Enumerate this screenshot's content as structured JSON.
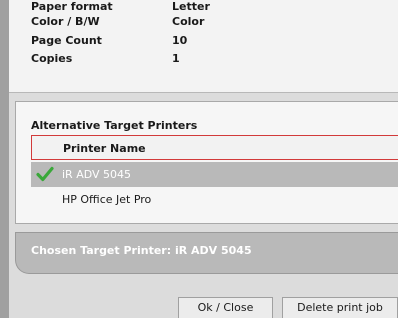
{
  "details": [
    {
      "label": "Paper format",
      "value": "Letter"
    },
    {
      "label": "Color / B/W",
      "value": "Color"
    },
    {
      "label": "Page Count",
      "value": "10"
    },
    {
      "label": "Copies",
      "value": "1"
    }
  ],
  "alternatives": {
    "title": "Alternative Target Printers",
    "column_header": "Printer Name",
    "printers": [
      {
        "name": "iR ADV 5045",
        "selected": true,
        "icon": "checkmark-icon"
      },
      {
        "name": "HP Office Jet Pro",
        "selected": false
      }
    ]
  },
  "chosen": {
    "text": "Chosen Target Printer: iR ADV 5045"
  },
  "buttons": {
    "ok": "Ok / Close",
    "delete": "Delete print job"
  },
  "colors": {
    "selected_row": "#b9b9b9",
    "header_border": "#d23a3a",
    "check": "#3aa83a"
  }
}
